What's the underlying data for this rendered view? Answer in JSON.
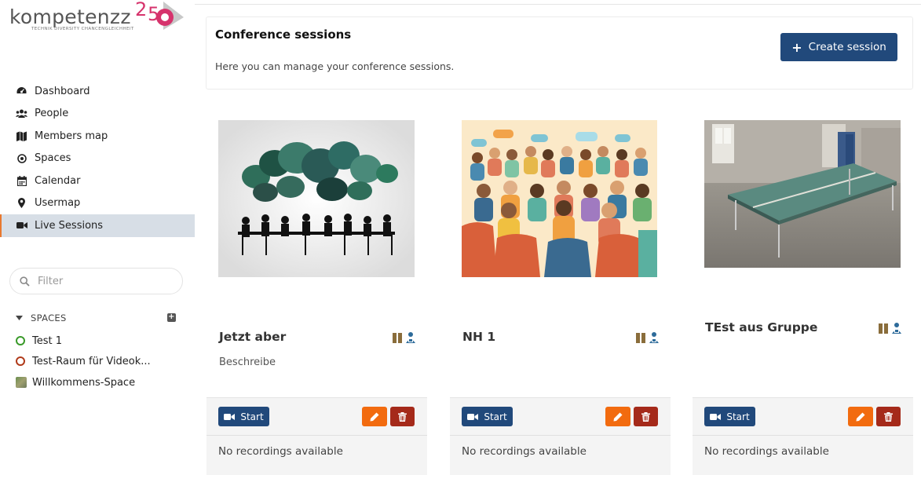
{
  "brand": {
    "logo_text": "kompetenzz",
    "logo_tagline": "TECHNIK DIVERSITY CHANCENGLEICHHEIT",
    "logo_badge": "25"
  },
  "sidebar": {
    "nav": [
      {
        "label": "Dashboard",
        "icon": "dashboard-icon",
        "active": false
      },
      {
        "label": "People",
        "icon": "people-icon",
        "active": false
      },
      {
        "label": "Members map",
        "icon": "map-icon",
        "active": false
      },
      {
        "label": "Spaces",
        "icon": "target-icon",
        "active": false
      },
      {
        "label": "Calendar",
        "icon": "calendar-icon",
        "active": false
      },
      {
        "label": "Usermap",
        "icon": "map-marker-icon",
        "active": false
      },
      {
        "label": "Live Sessions",
        "icon": "video-camera-icon",
        "active": true
      }
    ],
    "filter_placeholder": "Filter",
    "spaces_heading": "SPACES",
    "spaces": [
      {
        "label": "Test 1",
        "color": "#3a9a2a"
      },
      {
        "label": "Test-Raum für Videok...",
        "color": "#b03a1a"
      },
      {
        "label": "Willkommens-Space",
        "color": "image"
      }
    ]
  },
  "header": {
    "title": "Conference sessions",
    "description": "Here you can manage your conference sessions.",
    "create_button": "Create session"
  },
  "sessions": [
    {
      "title": "Jetzt aber",
      "description": "Beschreibe",
      "start_label": "Start",
      "recordings": "No recordings available"
    },
    {
      "title": "NH 1",
      "description": "",
      "start_label": "Start",
      "recordings": "No recordings available"
    },
    {
      "title": "TEst aus Gruppe",
      "description": "",
      "start_label": "Start",
      "recordings": "No recordings available"
    }
  ],
  "colors": {
    "primary": "#21497b",
    "edit": "#f26b0f",
    "delete": "#a52a1a",
    "active_nav_bg": "#d7dee6",
    "active_nav_border": "#e8792f"
  }
}
